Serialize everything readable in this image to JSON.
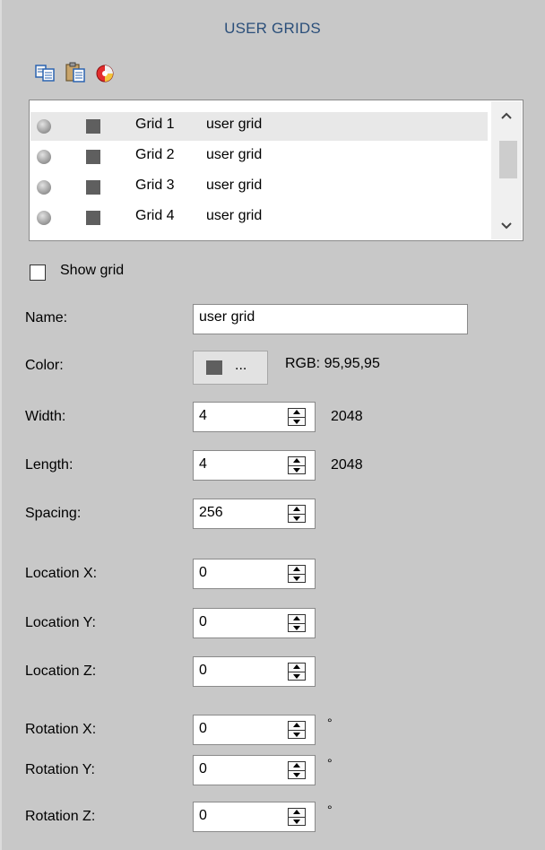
{
  "panel": {
    "title": "USER GRIDS"
  },
  "toolbar": {
    "icons": [
      "copy-icon",
      "paste-icon",
      "color-wheel-icon"
    ]
  },
  "grid_list": {
    "items": [
      {
        "name": "Grid 1",
        "description": "user grid",
        "selected": true
      },
      {
        "name": "Grid 2",
        "description": "user grid",
        "selected": false
      },
      {
        "name": "Grid 3",
        "description": "user grid",
        "selected": false
      },
      {
        "name": "Grid 4",
        "description": "user grid",
        "selected": false
      }
    ],
    "swatch_color": "#5f5f5f"
  },
  "show_grid": {
    "label": "Show grid",
    "checked": false
  },
  "name_field": {
    "label": "Name:",
    "value": "user grid"
  },
  "color_field": {
    "label": "Color:",
    "button_text": "...",
    "rgb_text": "RGB: 95,95,95",
    "swatch": "#5f5f5f"
  },
  "width_field": {
    "label": "Width:",
    "value": "4",
    "computed": "2048"
  },
  "length_field": {
    "label": "Length:",
    "value": "4",
    "computed": "2048"
  },
  "spacing_field": {
    "label": "Spacing:",
    "value": "256"
  },
  "location_x": {
    "label": "Location X:",
    "value": "0"
  },
  "location_y": {
    "label": "Location Y:",
    "value": "0"
  },
  "location_z": {
    "label": "Location Z:",
    "value": "0"
  },
  "rotation_x": {
    "label": "Rotation X:",
    "value": "0",
    "unit": "°"
  },
  "rotation_y": {
    "label": "Rotation Y:",
    "value": "0",
    "unit": "°"
  },
  "rotation_z": {
    "label": "Rotation Z:",
    "value": "0",
    "unit": "°"
  }
}
